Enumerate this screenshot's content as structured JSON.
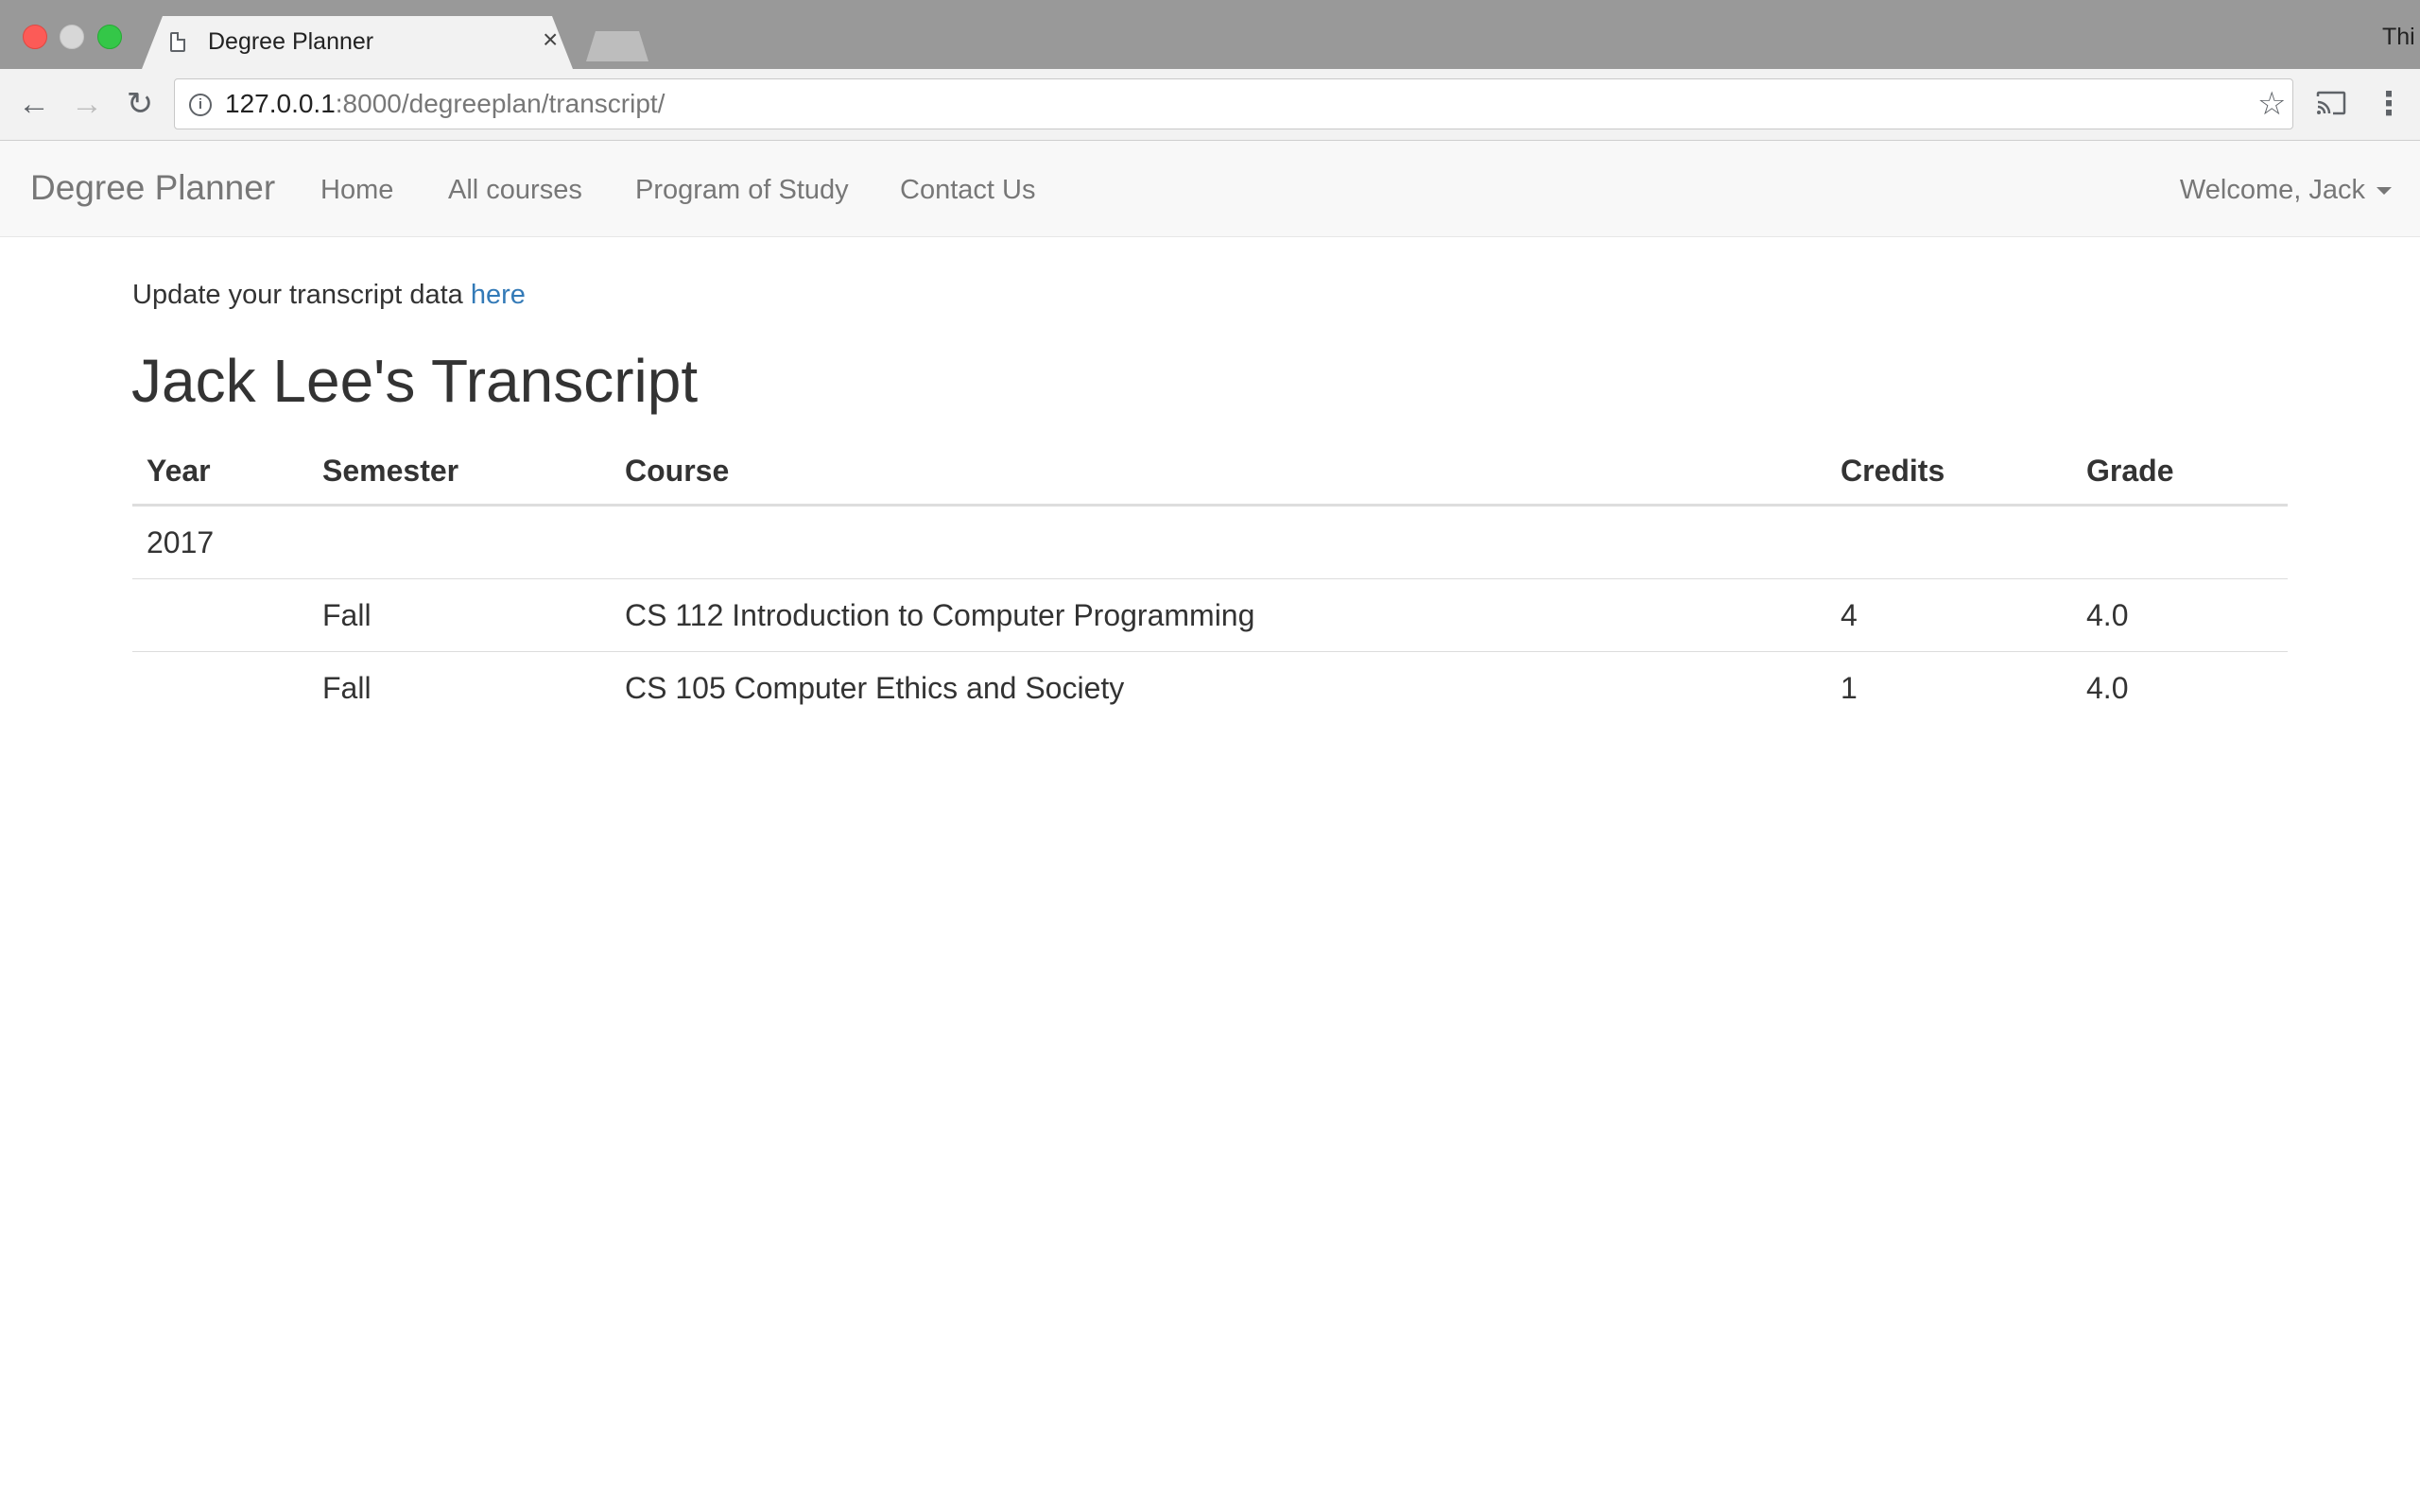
{
  "browser": {
    "tab_title": "Degree Planner",
    "tab_close": "×",
    "profile_label": "Thi",
    "url_host": "127.0.0.1",
    "url_path": ":8000/degreeplan/transcript/"
  },
  "navbar": {
    "brand": "Degree Planner",
    "links": [
      "Home",
      "All courses",
      "Program of Study",
      "Contact Us"
    ],
    "welcome": "Welcome, Jack"
  },
  "content": {
    "update_prefix": "Update your transcript data ",
    "update_link": "here",
    "title": "Jack Lee's Transcript"
  },
  "table": {
    "headers": [
      "Year",
      "Semester",
      "Course",
      "Credits",
      "Grade"
    ],
    "rows": [
      [
        "2017",
        "",
        "",
        "",
        ""
      ],
      [
        "",
        "Fall",
        "CS 112 Introduction to Computer Programming",
        "4",
        "4.0"
      ],
      [
        "",
        "Fall",
        "CS 105 Computer Ethics and Society",
        "1",
        "4.0"
      ]
    ]
  },
  "colors": {
    "link": "#337ab7",
    "navbar_bg": "#f8f8f8",
    "text": "#333333",
    "nav_text": "#777777"
  }
}
